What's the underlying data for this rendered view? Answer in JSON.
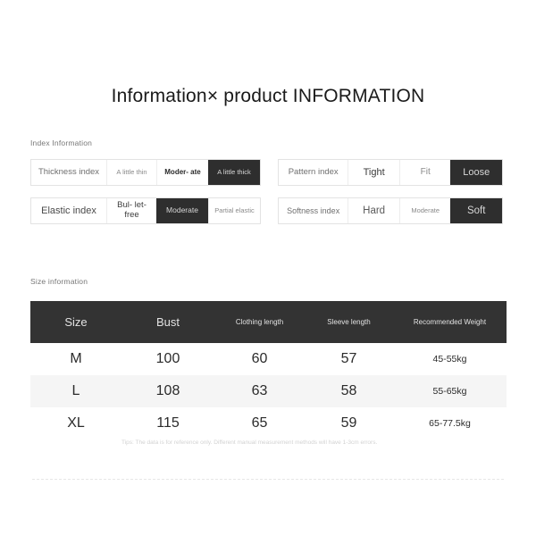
{
  "page": {
    "title": "Information× product INFORMATION"
  },
  "index_section": {
    "caption": "Index Information",
    "rows": [
      {
        "label": "Thickness index",
        "options": [
          {
            "label": "A little\nthin",
            "selected": false,
            "emphasis": false
          },
          {
            "label": "Moder-\nate",
            "selected": false,
            "emphasis": true
          },
          {
            "label": "A little\nthick",
            "selected": true,
            "emphasis": false
          }
        ]
      },
      {
        "label": "Elastic index",
        "options": [
          {
            "label": "Bul-\nlet-free",
            "selected": false,
            "emphasis": false
          },
          {
            "label": "Moderate",
            "selected": true,
            "emphasis": false
          },
          {
            "label": "Partial\nelastic",
            "selected": false,
            "emphasis": false
          }
        ]
      },
      {
        "label": "Pattern index",
        "options": [
          {
            "label": "Tight",
            "selected": false,
            "emphasis": false
          },
          {
            "label": "Fit",
            "selected": false,
            "emphasis": false
          },
          {
            "label": "Loose",
            "selected": true,
            "emphasis": false
          }
        ]
      },
      {
        "label": "Softness index",
        "options": [
          {
            "label": "Hard",
            "selected": false,
            "emphasis": false
          },
          {
            "label": "Moderate",
            "selected": false,
            "emphasis": false
          },
          {
            "label": "Soft",
            "selected": true,
            "emphasis": false
          }
        ]
      }
    ],
    "cells": {
      "thickness_label": "Thickness index",
      "thickness_opt1": "A little thin",
      "thickness_opt2": "Moder- ate",
      "thickness_opt3": "A little thick",
      "elastic_label": "Elastic index",
      "elastic_opt1": "Bul- let-free",
      "elastic_opt2": "Moderate",
      "elastic_opt3": "Partial elastic",
      "pattern_label": "Pattern index",
      "pattern_opt1": "Tight",
      "pattern_opt2": "Fit",
      "pattern_opt3": "Loose",
      "softness_label": "Softness index",
      "softness_opt1": "Hard",
      "softness_opt2": "Moderate",
      "softness_opt3": "Soft"
    }
  },
  "size_section": {
    "caption": "Size information",
    "headers": {
      "size": "Size",
      "bust": "Bust",
      "clothing_length": "Clothing length",
      "sleeve_length": "Sleeve length",
      "recommended_weight": "Recommended Weight"
    },
    "rows": [
      {
        "size": "M",
        "bust": "100",
        "clothing_length": "60",
        "sleeve_length": "57",
        "recommended_weight": "45-55kg"
      },
      {
        "size": "L",
        "bust": "108",
        "clothing_length": "63",
        "sleeve_length": "58",
        "recommended_weight": "55-65kg"
      },
      {
        "size": "XL",
        "bust": "115",
        "clothing_length": "65",
        "sleeve_length": "59",
        "recommended_weight": "65-77.5kg"
      }
    ],
    "tips": "Tips: The data is for reference only. Different manual measurement methods will have 1-3cm errors."
  },
  "colors": {
    "selected_cell": "#2e2e2e",
    "table_header": "#333333",
    "alt_row": "#f5f5f5",
    "border": "#e3e3e3",
    "page_background": "#ffffff"
  }
}
